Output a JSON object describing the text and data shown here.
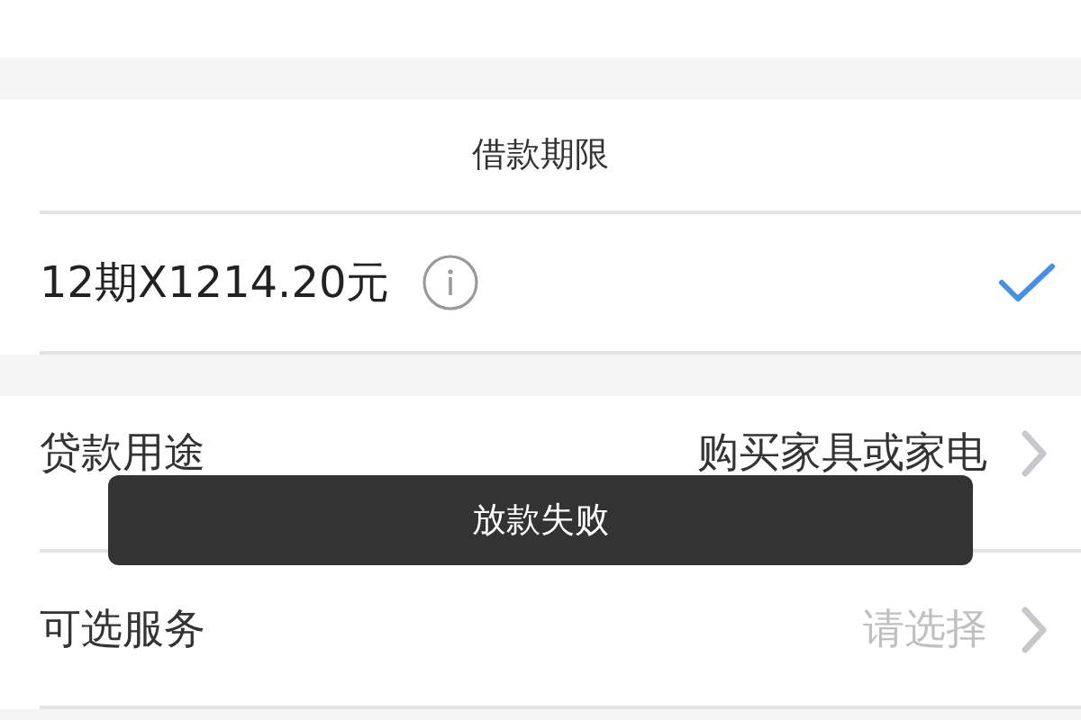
{
  "term_section": {
    "title": "借款期限",
    "options": [
      {
        "label": "12期X1214.20元",
        "selected": true
      }
    ]
  },
  "form_rows": [
    {
      "label": "贷款用途",
      "value": "购买家具或家电"
    },
    {
      "label": "可选服务",
      "placeholder": "请选择"
    }
  ],
  "toast": {
    "message": "放款失败"
  }
}
